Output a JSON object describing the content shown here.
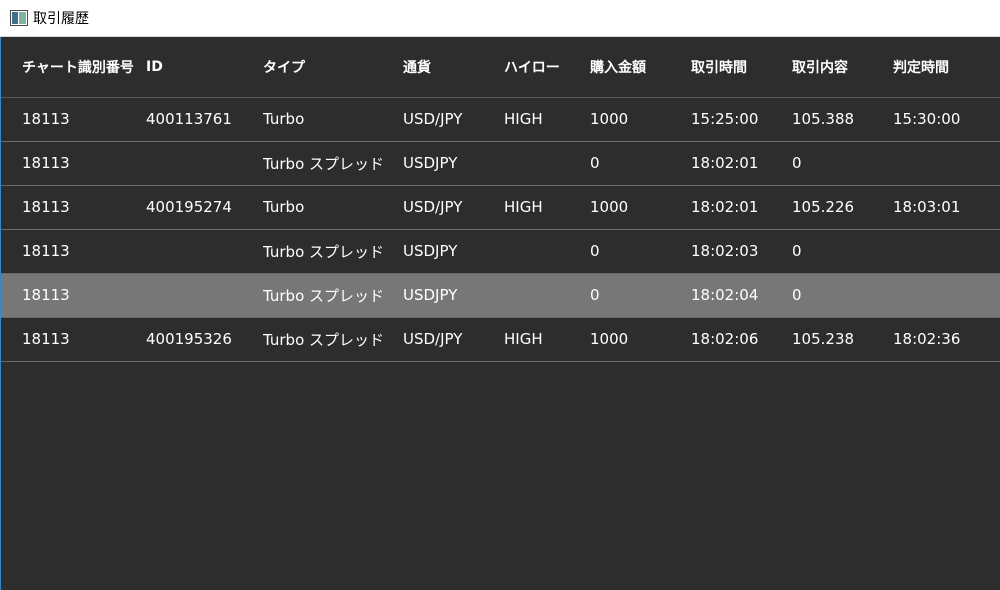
{
  "window": {
    "title": "取引履歴",
    "icon": "window-app-icon"
  },
  "table": {
    "columns": [
      "チャート識別番号",
      "ID",
      "タイプ",
      "通貨",
      "ハイロー",
      "購入金額",
      "取引時間",
      "取引内容",
      "判定時間"
    ],
    "rows": [
      [
        "18113",
        "400113761",
        "Turbo",
        "USD/JPY",
        "HIGH",
        "1000",
        "15:25:00",
        "105.388",
        "15:30:00"
      ],
      [
        "18113",
        "",
        "Turbo スプレッド",
        "USDJPY",
        "",
        "0",
        "18:02:01",
        "0",
        ""
      ],
      [
        "18113",
        "400195274",
        "Turbo",
        "USD/JPY",
        "HIGH",
        "1000",
        "18:02:01",
        "105.226",
        "18:03:01"
      ],
      [
        "18113",
        "",
        "Turbo スプレッド",
        "USDJPY",
        "",
        "0",
        "18:02:03",
        "0",
        ""
      ],
      [
        "18113",
        "",
        "Turbo スプレッド",
        "USDJPY",
        "",
        "0",
        "18:02:04",
        "0",
        ""
      ],
      [
        "18113",
        "400195326",
        "Turbo スプレッド",
        "USD/JPY",
        "HIGH",
        "1000",
        "18:02:06",
        "105.238",
        "18:02:36"
      ]
    ],
    "selected_row": 4
  },
  "colors": {
    "background": "#2d2d2d",
    "selected_row": "#777777",
    "text": "#ffffff",
    "window_border": "#3a87c7"
  }
}
